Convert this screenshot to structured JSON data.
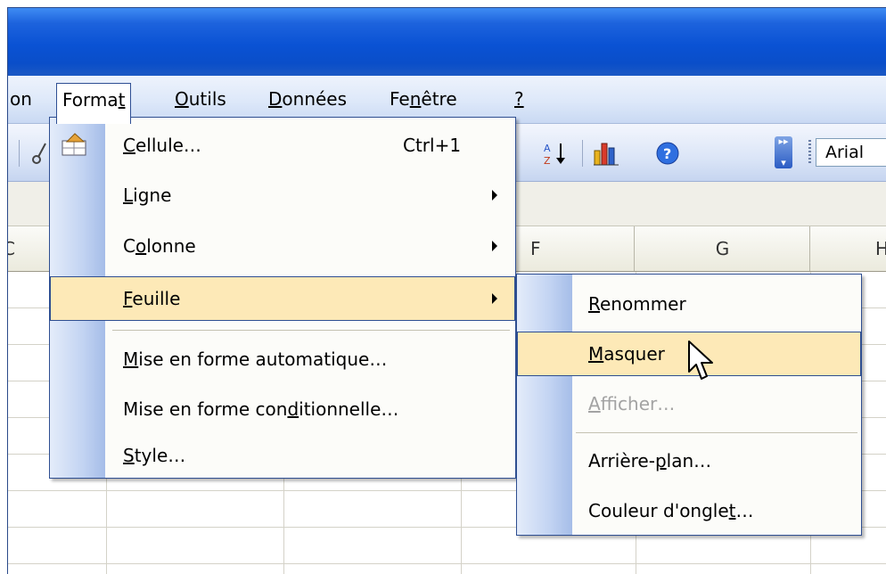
{
  "menubar": {
    "items": [
      {
        "pre": "on",
        "acc": "",
        "post": ""
      },
      {
        "pre": "Forma",
        "acc": "t",
        "post": ""
      },
      {
        "pre": "",
        "acc": "O",
        "post": "utils"
      },
      {
        "pre": "",
        "acc": "D",
        "post": "onnées"
      },
      {
        "pre": "Fe",
        "acc": "n",
        "post": "être"
      },
      {
        "pre": "",
        "acc": "?",
        "post": ""
      }
    ]
  },
  "toolbar": {
    "font_name": "Arial",
    "icons": [
      "cut-icon",
      "sort-ascending-icon",
      "chart-wizard-icon",
      "help-icon",
      "toolbar-options-icon"
    ]
  },
  "columns": [
    "C",
    "F",
    "G",
    "H"
  ],
  "format_menu": {
    "items": [
      {
        "pre": "",
        "acc": "C",
        "post": "ellule…",
        "shortcut": "Ctrl+1",
        "submenu": false
      },
      {
        "pre": "",
        "acc": "L",
        "post": "igne",
        "submenu": true
      },
      {
        "pre": "C",
        "acc": "o",
        "post": "lonne",
        "submenu": true
      },
      {
        "pre": "",
        "acc": "F",
        "post": "euille",
        "submenu": true,
        "highlighted": true
      },
      {
        "pre": "",
        "acc": "M",
        "post": "ise en forme automatique…"
      },
      {
        "pre": "Mise en forme con",
        "acc": "d",
        "post": "itionnelle…"
      },
      {
        "pre": "",
        "acc": "S",
        "post": "tyle…"
      }
    ]
  },
  "sheet_submenu": {
    "items": [
      {
        "pre": "",
        "acc": "R",
        "post": "enommer"
      },
      {
        "pre": "",
        "acc": "M",
        "post": "asquer",
        "highlighted": true
      },
      {
        "pre": "",
        "acc": "A",
        "post": "fficher…",
        "disabled": true
      },
      {
        "pre": "Arrière-",
        "acc": "p",
        "post": "lan…"
      },
      {
        "pre": "Couleur d'ongle",
        "acc": "t",
        "post": "…"
      }
    ]
  },
  "colors": {
    "titlebar": "#0a52d4",
    "menu_border": "#2e4e91",
    "highlight": "#fde9b7"
  }
}
